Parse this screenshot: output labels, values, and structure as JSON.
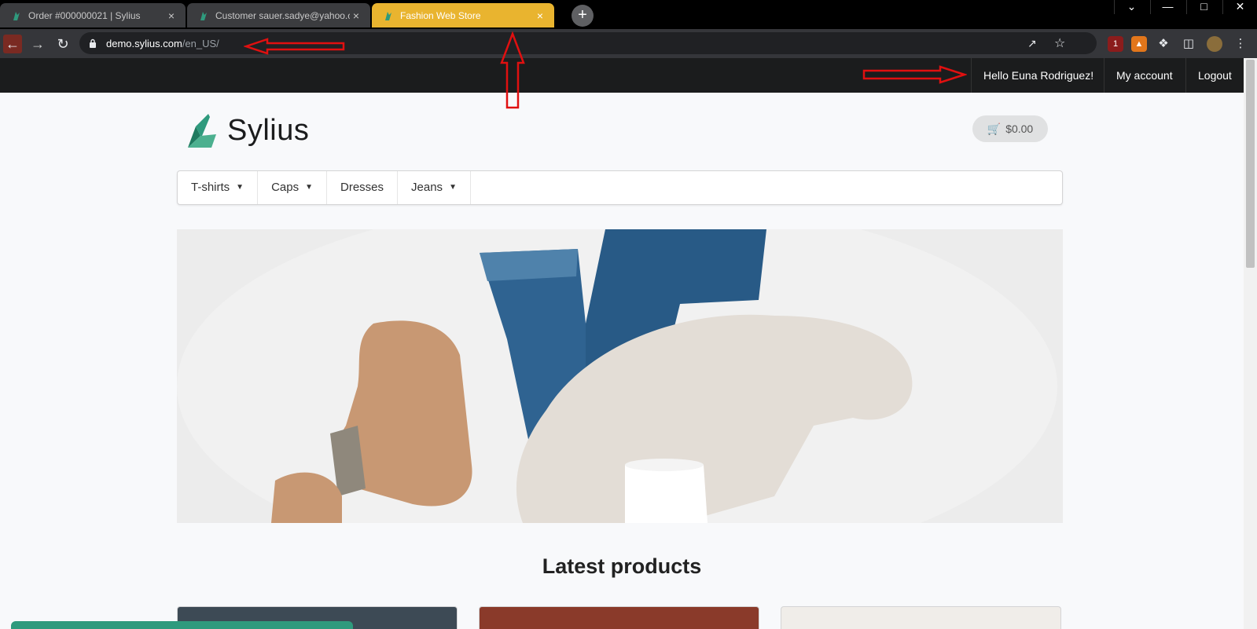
{
  "browser": {
    "tabs": [
      {
        "title": "Order #000000021 | Sylius",
        "active": false
      },
      {
        "title": "Customer sauer.sadye@yahoo.co",
        "active": false
      },
      {
        "title": "Fashion Web Store",
        "active": true
      }
    ],
    "new_tab_label": "+",
    "close_label": "×",
    "url_host": "demo.sylius.com",
    "url_path": "/en_US/",
    "extension_badge": "1"
  },
  "topbar": {
    "greeting": "Hello Euna Rodriguez!",
    "account_label": "My account",
    "logout_label": "Logout"
  },
  "header": {
    "brand": "Sylius",
    "cart_total": "$0.00"
  },
  "menu": {
    "items": [
      {
        "label": "T-shirts",
        "has_dropdown": true
      },
      {
        "label": "Caps",
        "has_dropdown": true
      },
      {
        "label": "Dresses",
        "has_dropdown": false
      },
      {
        "label": "Jeans",
        "has_dropdown": true
      }
    ]
  },
  "main": {
    "section_title": "Latest products"
  },
  "colors": {
    "active_tab": "#e9b42f",
    "site_topbar": "#1b1c1d",
    "brand_green": "#2f9a7d",
    "annotation": "#e01010"
  }
}
